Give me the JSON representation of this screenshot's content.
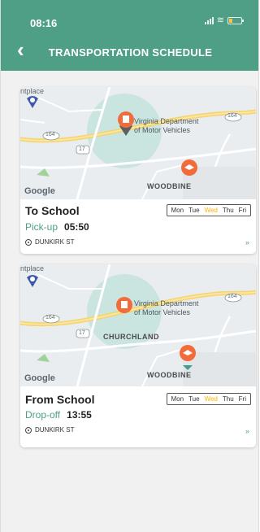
{
  "status": {
    "time": "08:16"
  },
  "header": {
    "title": "TRANSPORTATION SCHEDULE"
  },
  "map": {
    "place_label": "ntplace",
    "dmv_line1": "Virginia Department",
    "dmv_line2": "of Motor Vehicles",
    "area_label": "WOODBINE",
    "area_label_2": "CHURCHLAND",
    "route_164": "164",
    "route_17": "17",
    "google": "Google"
  },
  "days": [
    "Mon",
    "Tue",
    "Wed",
    "Thu",
    "Fri"
  ],
  "active_day": "Wed",
  "schedules": [
    {
      "title": "To School",
      "time_label": "Pick-up",
      "time": "05:50",
      "address": "DUNKIRK ST"
    },
    {
      "title": "From School",
      "time_label": "Drop-off",
      "time": "13:55",
      "address": "DUNKIRK ST"
    }
  ],
  "colors": {
    "primary": "#4f9f86",
    "active_day": "#ffb300",
    "pin": "#f26b3a"
  }
}
